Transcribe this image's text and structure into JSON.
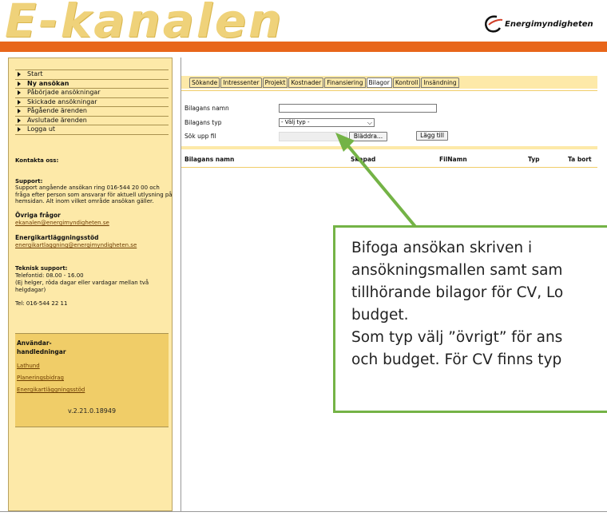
{
  "header": {
    "logo": "E-kanalen",
    "agency": "Energimyndigheten",
    "colors": {
      "brand_orange": "#e8661a",
      "sidebar": "#fde9a8",
      "highlight": "#f0cd68",
      "callout_border": "#74b346"
    }
  },
  "sidebar": {
    "nav": [
      {
        "label": "Start",
        "bold": false
      },
      {
        "label": "Ny ansökan",
        "bold": true
      },
      {
        "label": "Påbörjade ansökningar",
        "bold": false
      },
      {
        "label": "Skickade ansökningar",
        "bold": false
      },
      {
        "label": "Pågående ärenden",
        "bold": false
      },
      {
        "label": "Avslutade ärenden",
        "bold": false
      },
      {
        "label": "Logga ut",
        "bold": false
      }
    ],
    "contact_heading": "Kontakta oss:",
    "support_heading": "Support:",
    "support_text": "Support angående ansökan ring 016-544 20 00 och fråga efter person som ansvarar för aktuell utlysning på hemsidan. Alt inom vilket område ansökan gäller.",
    "other_heading": "Övriga frågor",
    "other_email": "ekanalen@energimyndigheten.se",
    "mapping_heading": "Energikartläggningsstöd",
    "mapping_email": "energikartlaggning@energimyndigheten.se",
    "tech_heading": "Teknisk support:",
    "tech_hours": "Telefontid: 08.00 - 16.00",
    "tech_note": "(Ej helger, röda dagar eller vardagar mellan två helgdagar)",
    "tech_phone": "Tel: 016-544 22 11",
    "manuals_heading": "Användar-\nhandledningar",
    "manual_links": [
      "Lathund",
      "Planeringsbidrag",
      "Energikartläggningsstöd"
    ],
    "version": "v.2.21.0.18949"
  },
  "main": {
    "tabs": [
      {
        "label": "Sökande",
        "active": false
      },
      {
        "label": "Intressenter",
        "active": false
      },
      {
        "label": "Projekt",
        "active": false
      },
      {
        "label": "Kostnader",
        "active": false
      },
      {
        "label": "Finansiering",
        "active": false
      },
      {
        "label": "Bilagor",
        "active": true
      },
      {
        "label": "Kontroll",
        "active": false
      },
      {
        "label": "Insändning",
        "active": false
      }
    ],
    "form": {
      "name_label": "Bilagans namn",
      "name_value": "",
      "type_label": "Bilagans typ",
      "type_value": "- Välj typ -",
      "file_label": "Sök upp fil",
      "browse_button": "Bläddra...",
      "add_button": "Lägg till"
    },
    "table": {
      "columns": [
        "Bilagans namn",
        "Skapad",
        "FilNamn",
        "Typ",
        "Ta bort"
      ]
    }
  },
  "callout": {
    "text": "Bifoga ansökan skriven i\nansökningsmallen samt sam\ntillhörande bilagor för CV, Lo\nbudget.\nSom typ välj ”övrigt” för ans\noch budget. För CV finns typ"
  }
}
